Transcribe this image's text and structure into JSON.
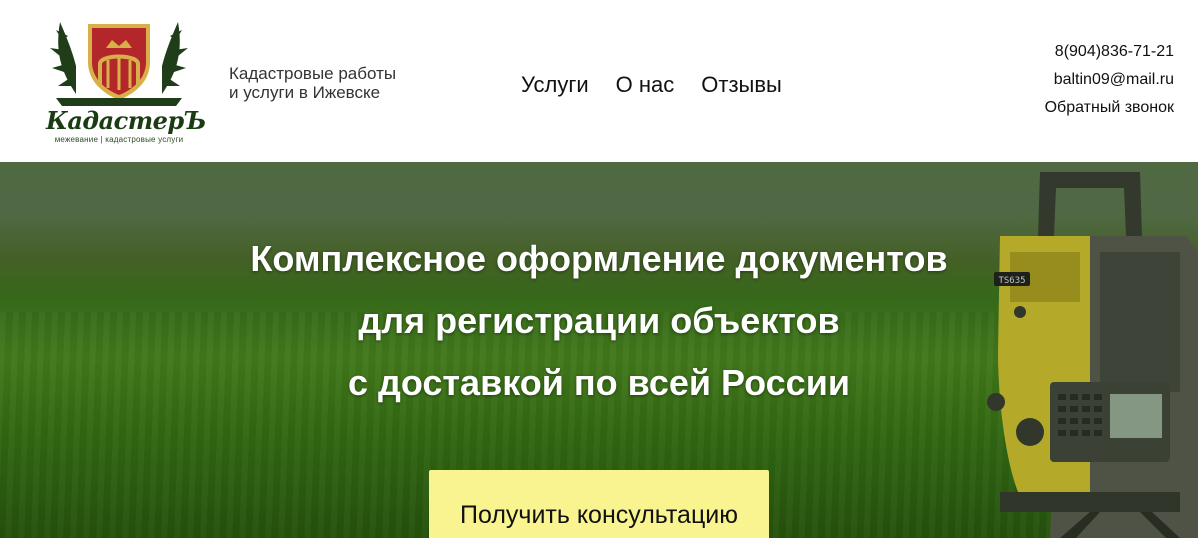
{
  "header": {
    "logo": {
      "wordmark": "КадастерЪ",
      "subtitle": "межевание | кадастровые услуги"
    },
    "tagline_line1": "Кадастровые работы",
    "tagline_line2": "и услуги в Ижевске",
    "nav": [
      "Услуги",
      "О нас",
      "Отзывы"
    ],
    "contacts": {
      "phone": "8(904)836-71-21",
      "email": "baltin09@mail.ru",
      "callback": "Обратный звонок"
    }
  },
  "hero": {
    "title_lines": [
      "Комплексное оформление документов",
      "для регистрации объектов",
      "с доставкой по всей России"
    ],
    "cta_label": "Получить консультацию",
    "instrument_display": "TS635"
  },
  "colors": {
    "cta_background": "#f9f48f",
    "logo_green": "#1b3b14",
    "shield_red": "#b3262a",
    "shield_gold": "#d8b04a",
    "field_green": "#4f8e22"
  }
}
